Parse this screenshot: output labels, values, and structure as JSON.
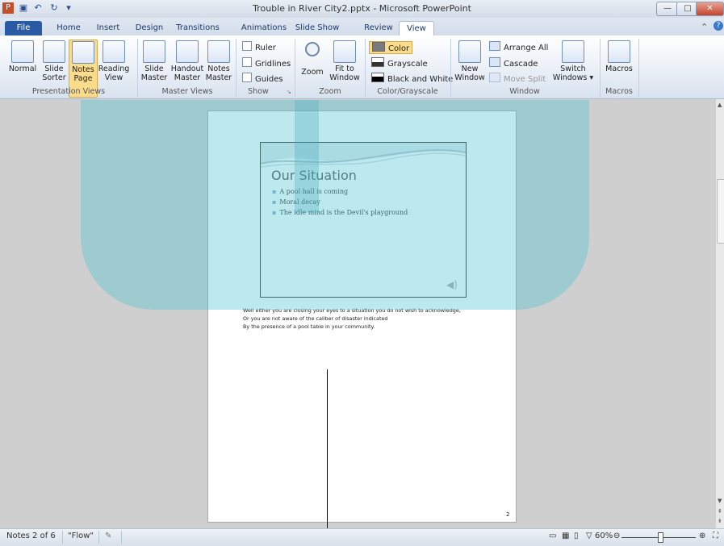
{
  "app": {
    "title": "Trouble in River City2.pptx - Microsoft PowerPoint"
  },
  "qat": {
    "undo": "↶",
    "redo": "↻",
    "save": "▣",
    "menu": "▾"
  },
  "window": {
    "minimize": "—",
    "maximize": "□",
    "close": "✕"
  },
  "tabs": [
    "File",
    "Home",
    "Insert",
    "Design",
    "Transitions",
    "Animations",
    "Slide Show",
    "Review",
    "View"
  ],
  "ribbon": {
    "presentation_views": {
      "label": "Presentation Views",
      "buttons": [
        {
          "line1": "Normal",
          "line2": ""
        },
        {
          "line1": "Slide",
          "line2": "Sorter"
        },
        {
          "line1": "Notes",
          "line2": "Page"
        },
        {
          "line1": "Reading",
          "line2": "View"
        }
      ]
    },
    "master_views": {
      "label": "Master Views",
      "buttons": [
        {
          "line1": "Slide",
          "line2": "Master"
        },
        {
          "line1": "Handout",
          "line2": "Master"
        },
        {
          "line1": "Notes",
          "line2": "Master"
        }
      ]
    },
    "show": {
      "label": "Show",
      "items": [
        "Ruler",
        "Gridlines",
        "Guides"
      ]
    },
    "zoom": {
      "label": "Zoom",
      "zoom_btn": "Zoom",
      "fit1": "Fit to",
      "fit2": "Window"
    },
    "color": {
      "label": "Color/Grayscale",
      "items": [
        "Color",
        "Grayscale",
        "Black and White"
      ]
    },
    "window": {
      "label": "Window",
      "new1": "New",
      "new2": "Window",
      "arrange": "Arrange All",
      "cascade": "Cascade",
      "move_split": "Move Split",
      "switch1": "Switch",
      "switch2": "Windows ▾"
    },
    "macros": {
      "label": "Macros",
      "button": "Macros"
    }
  },
  "slide": {
    "title": "Our Situation",
    "bullets": [
      "A pool hall is coming",
      "Moral decay",
      "The idle mind is the Devil's playground"
    ]
  },
  "notes": [
    "Well either you are closing your eyes to a situation you do not wish to acknowledge,",
    "Or you are not aware of the caliber of disaster indicated",
    "By the presence of a pool table in your community."
  ],
  "page_number": "2",
  "status": {
    "slide_info": "Notes 2 of 6",
    "theme": "\"Flow\"",
    "zoom": "60%",
    "zoom_fraction": 0.6
  }
}
